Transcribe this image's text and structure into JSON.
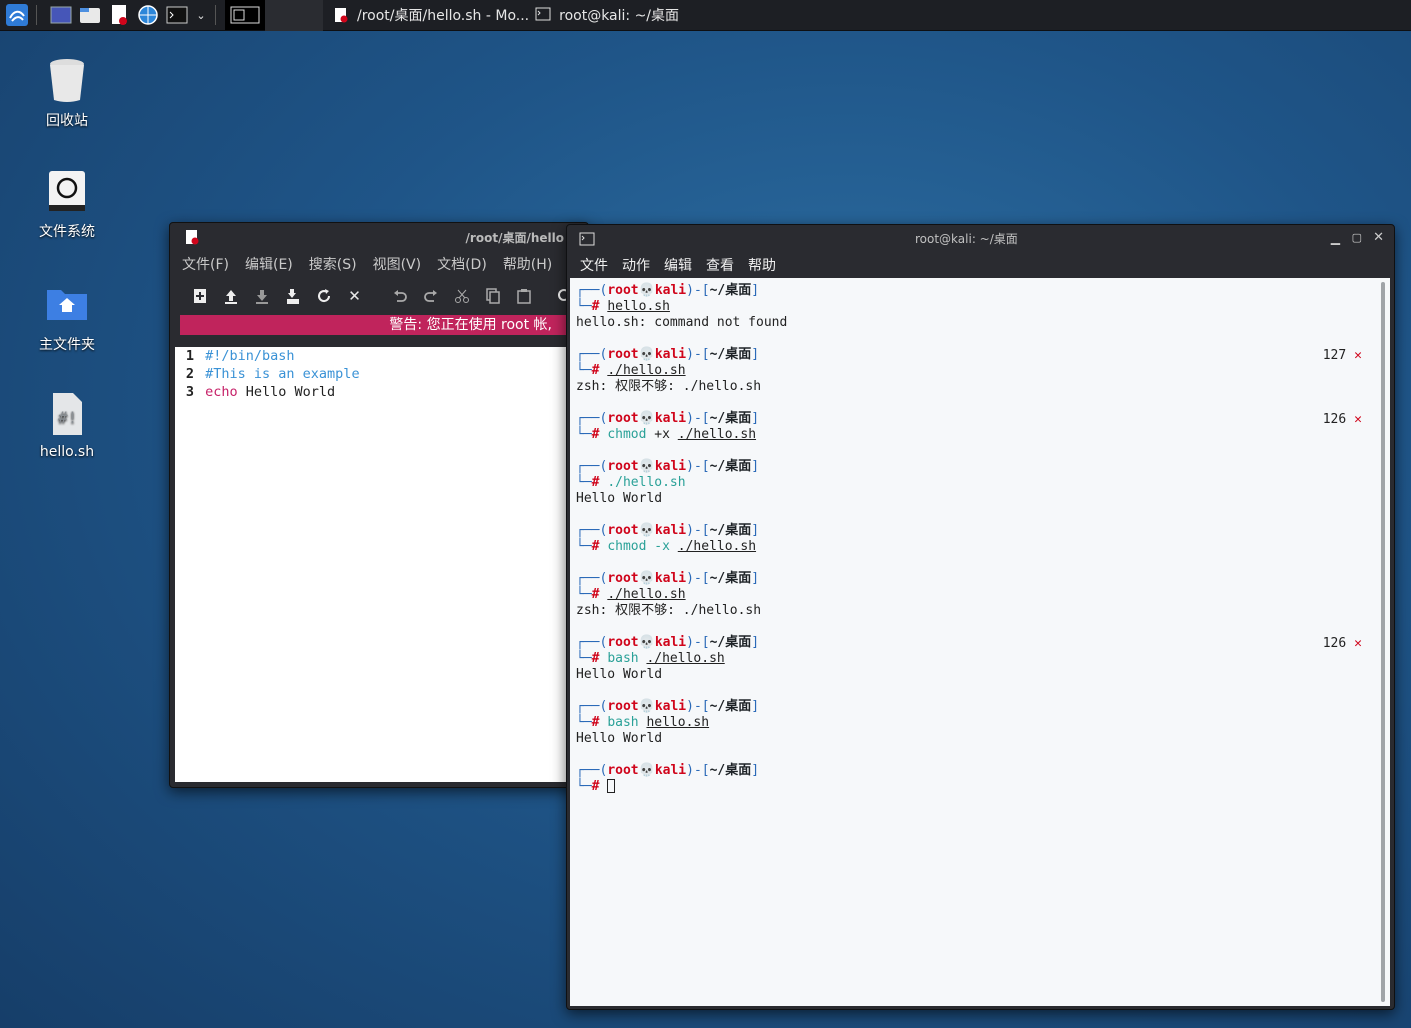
{
  "taskbar": {
    "tasks": [
      {
        "label": "/root/桌面/hello.sh - Mo..."
      },
      {
        "label": "root@kali: ~/桌面"
      }
    ]
  },
  "desktop": {
    "icons": [
      {
        "label": "回收站"
      },
      {
        "label": "文件系统"
      },
      {
        "label": "主文件夹"
      },
      {
        "label": "hello.sh"
      }
    ]
  },
  "mousepad": {
    "title": "/root/桌面/hello",
    "menu": [
      "文件(F)",
      "编辑(E)",
      "搜索(S)",
      "视图(V)",
      "文档(D)",
      "帮助(H)"
    ],
    "warning": "警告: 您正在使用 root 帐,",
    "lines": [
      {
        "num": "1",
        "text": "#!/bin/bash",
        "kind": "comment"
      },
      {
        "num": "2",
        "text": "#This is an example",
        "kind": "comment"
      },
      {
        "num": "3",
        "kw": "echo",
        "text": " Hello World",
        "kind": "echo"
      }
    ]
  },
  "terminal": {
    "title": "root@kali: ~/桌面",
    "menu": [
      "文件",
      "动作",
      "编辑",
      "查看",
      "帮助"
    ],
    "prompt": {
      "user": "root",
      "host": "kali",
      "dir": "~/桌面",
      "hash": "#"
    },
    "blocks": [
      {
        "cmd": [
          {
            "t": "hello.sh",
            "s": "u"
          }
        ],
        "out": [
          "hello.sh: command not found"
        ],
        "status": ""
      },
      {
        "cmd": [
          {
            "t": "./hello.sh",
            "s": "u"
          }
        ],
        "out": [
          "zsh: 权限不够: ./hello.sh"
        ],
        "status": "127"
      },
      {
        "cmd": [
          {
            "t": "chmod",
            "s": "c"
          },
          {
            "t": " +x ",
            "s": ""
          },
          {
            "t": "./hello.sh",
            "s": "u"
          }
        ],
        "out": [],
        "status": "126"
      },
      {
        "cmd": [
          {
            "t": "./hello.sh",
            "s": "c"
          }
        ],
        "out": [
          "Hello World"
        ],
        "status": ""
      },
      {
        "cmd": [
          {
            "t": "chmod",
            "s": "c"
          },
          {
            "t": " -x ",
            "s": "c"
          },
          {
            "t": "./hello.sh",
            "s": "u"
          }
        ],
        "out": [],
        "status": ""
      },
      {
        "cmd": [
          {
            "t": "./hello.sh",
            "s": "u"
          }
        ],
        "out": [
          "zsh: 权限不够: ./hello.sh"
        ],
        "status": ""
      },
      {
        "cmd": [
          {
            "t": "bash",
            "s": "c"
          },
          {
            "t": " ",
            "s": ""
          },
          {
            "t": "./hello.sh",
            "s": "u"
          }
        ],
        "out": [
          "Hello World"
        ],
        "status": "126"
      },
      {
        "cmd": [
          {
            "t": "bash",
            "s": "c"
          },
          {
            "t": " ",
            "s": ""
          },
          {
            "t": "hello.sh",
            "s": "u"
          }
        ],
        "out": [
          "Hello World"
        ],
        "status": ""
      },
      {
        "cmd": [],
        "out": [],
        "status": "",
        "cursor": true
      }
    ],
    "status_x": "✕"
  }
}
